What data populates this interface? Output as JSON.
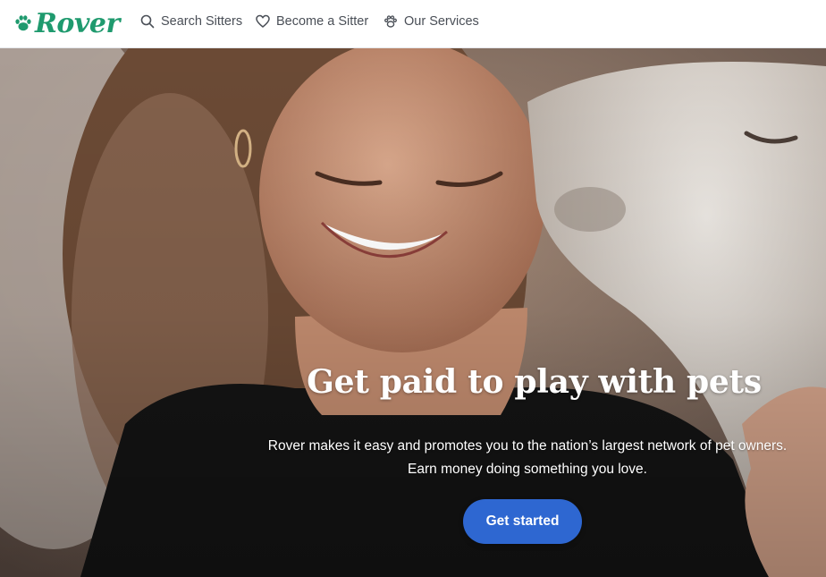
{
  "brand": {
    "name": "Rover",
    "color": "#1f9a6e",
    "icon": "paw-icon"
  },
  "nav": {
    "items": [
      {
        "label": "Search Sitters",
        "icon": "search-icon"
      },
      {
        "label": "Become a Sitter",
        "icon": "heart-icon"
      },
      {
        "label": "Our Services",
        "icon": "paw-icon"
      }
    ]
  },
  "hero": {
    "title": "Get paid to play with pets",
    "subtitle_line1": "Rover makes it easy and promotes you to the nation’s largest network of pet owners.",
    "subtitle_line2": "Earn money doing something you love.",
    "cta_label": "Get started",
    "cta_color": "#2e67d1",
    "image": "photo of a smiling woman with eyes closed being licked by a white dog"
  }
}
